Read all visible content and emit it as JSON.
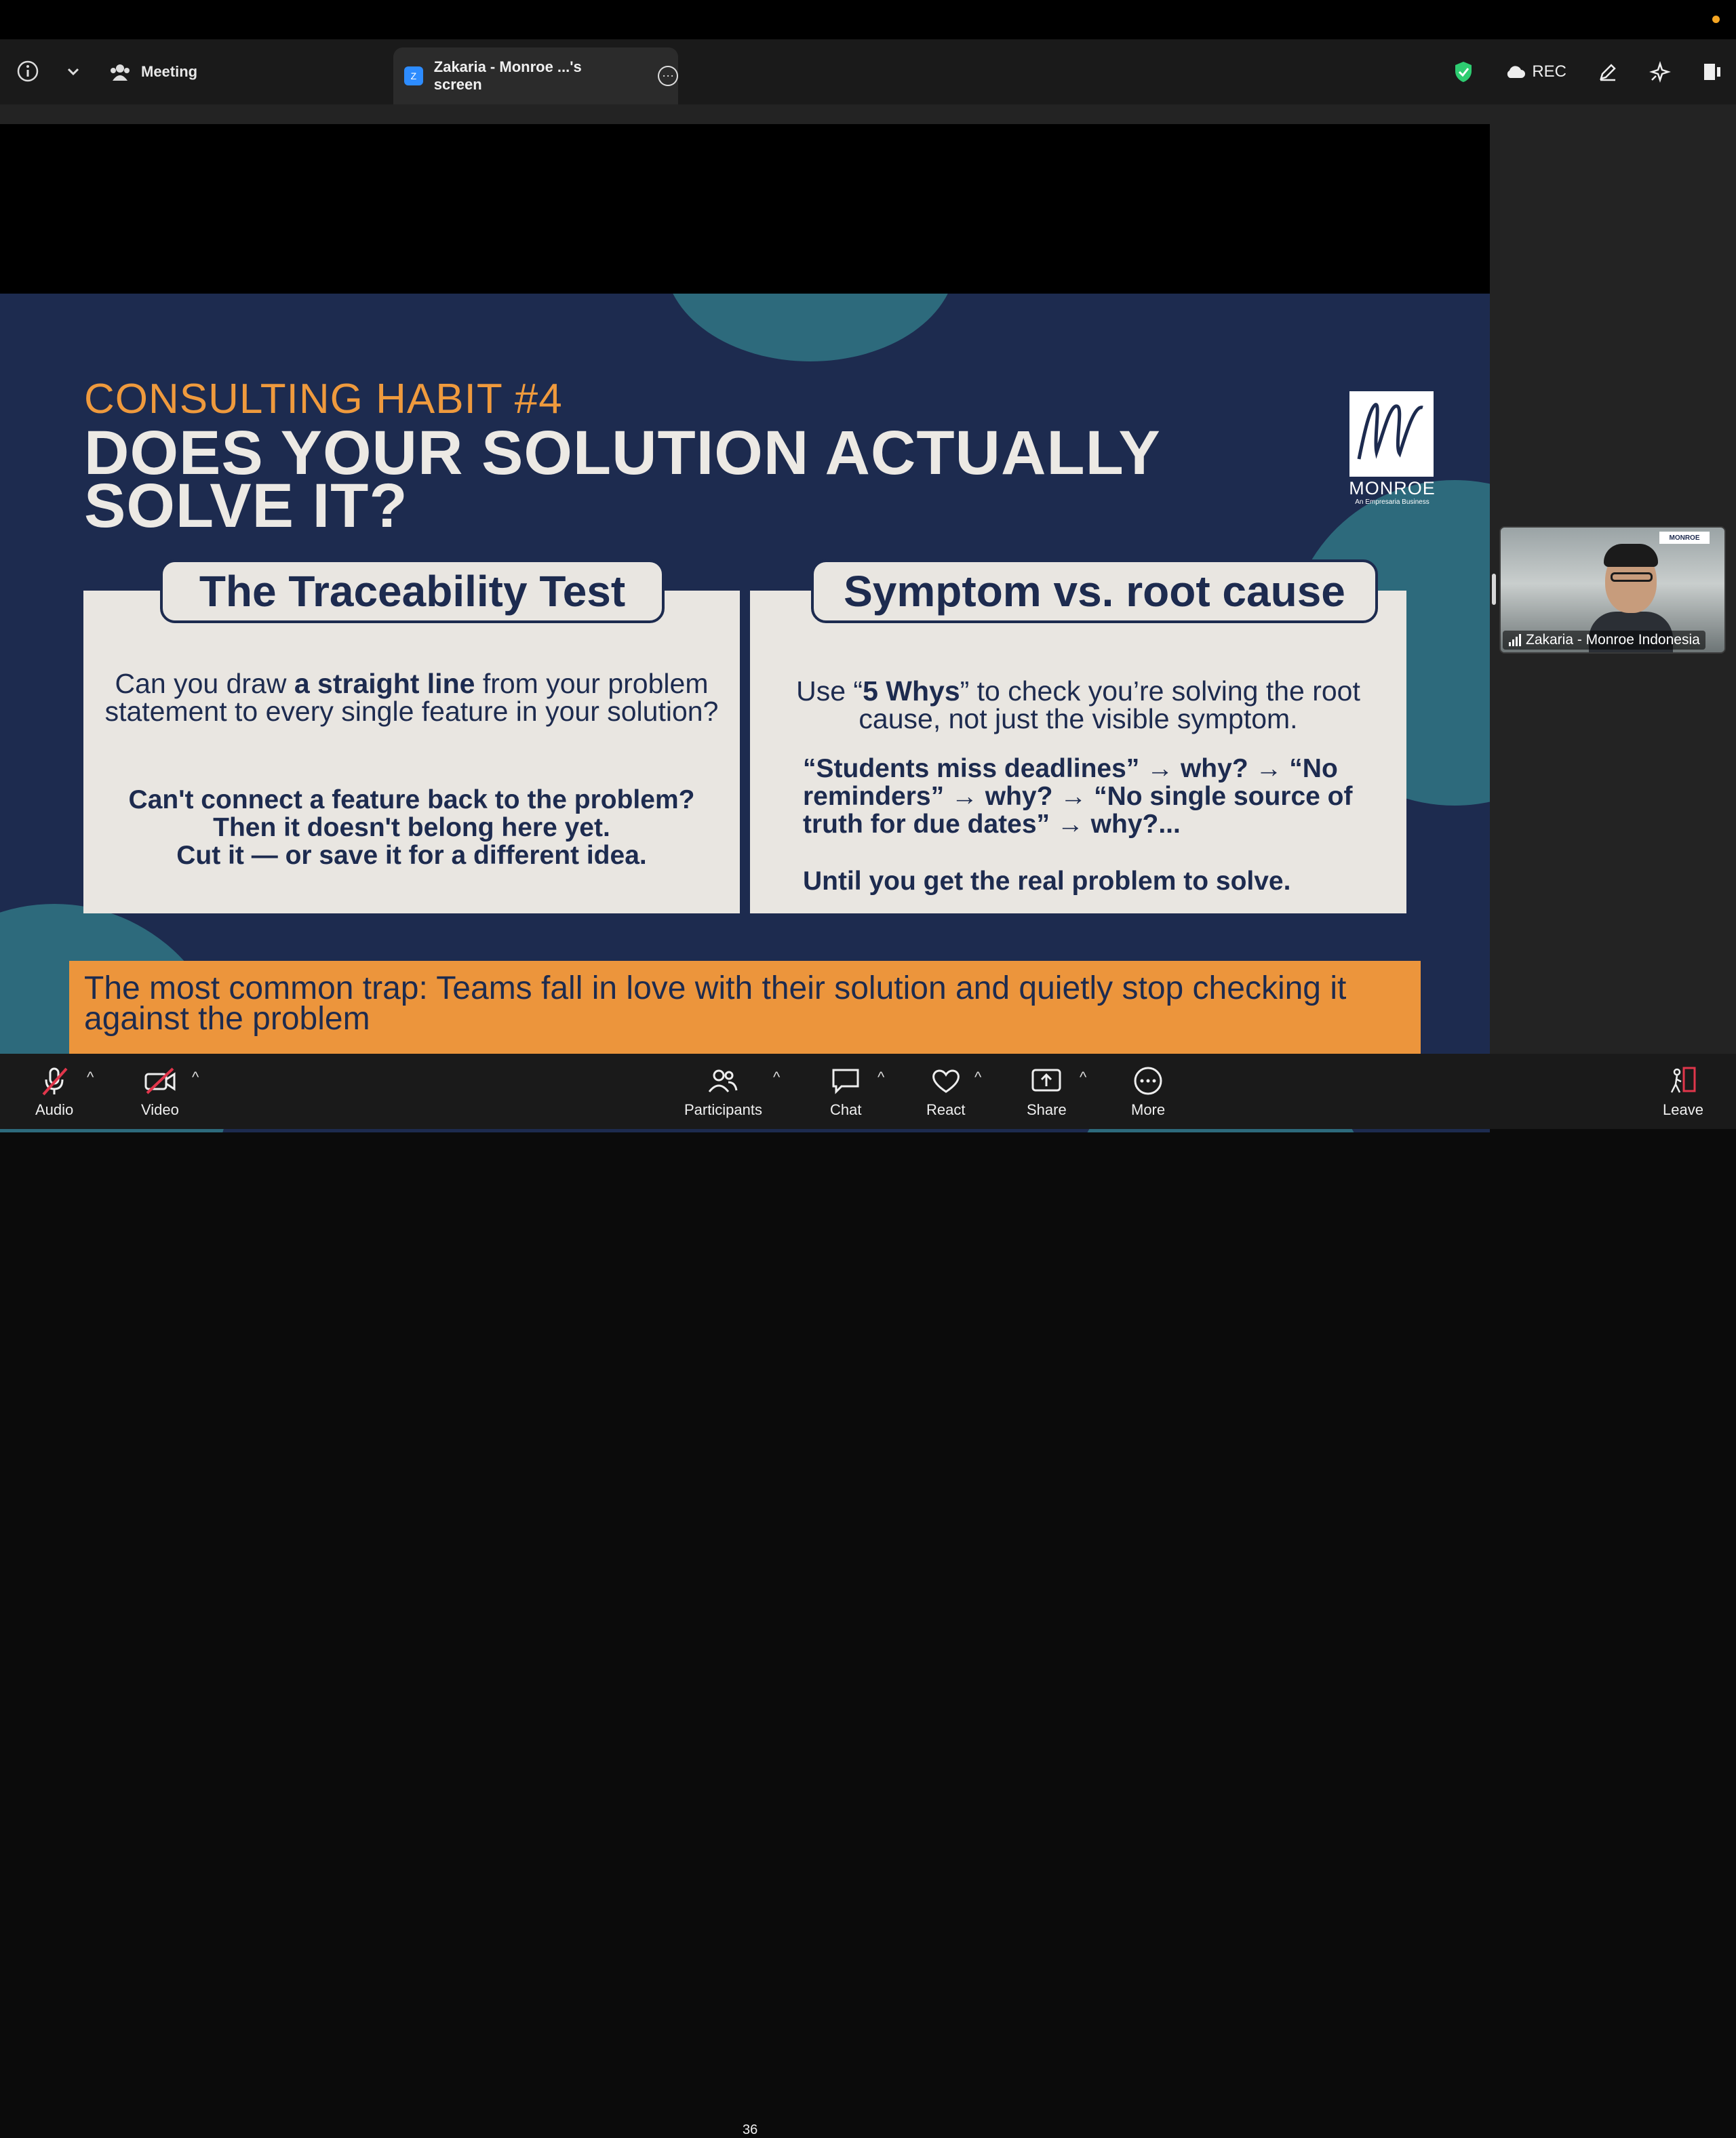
{
  "topbar": {
    "meeting_label": "Meeting",
    "share_tab_label": "Zakaria - Monroe ...'s screen",
    "share_tab_logo": "Z",
    "rec_label": "REC",
    "icons": [
      "info-icon",
      "chevron-down-icon",
      "participants-icon",
      "shield-check-icon",
      "cloud-icon",
      "pencil-icon",
      "sparkle-icon",
      "side-panel-icon"
    ],
    "shield_color": "#2ecc71"
  },
  "slide": {
    "kicker": "CONSULTING HABIT #4",
    "title": "DOES YOUR SOLUTION ACTUALLY SOLVE IT?",
    "logo_word": "MONROE",
    "logo_sub": "An Empresaria Business",
    "left_card": {
      "heading": "The Traceability Test",
      "question_prefix": "Can you draw ",
      "question_bold": "a straight line",
      "question_suffix": " from your problem statement to every single feature in your solution?",
      "strong_1": "Can't connect a feature back to the problem?",
      "strong_2": "Then it doesn't belong here yet.",
      "strong_3": "Cut it — or save it for a different idea."
    },
    "right_card": {
      "heading": "Symptom vs. root cause",
      "text_prefix": "Use “",
      "text_bold": "5 Whys",
      "text_suffix": "” to check you’re solving the root cause, not just the visible symptom.",
      "chain": "“Students miss deadlines” → why? → “No reminders” → why? → “No single source of truth for due dates” → why?...",
      "until": "Until you get the real problem to solve."
    },
    "banner": "The most common trap: Teams fall in love with their solution and quietly stop checking it against the problem",
    "colors": {
      "navy": "#1d2b4f",
      "orange": "#ec953c",
      "teal": "#2d6a7c",
      "card": "#e9e6e1"
    }
  },
  "video": {
    "name": "Zakaria - Monroe Indonesia",
    "mini_logo": "MONROE"
  },
  "bottombar": {
    "audio": "Audio",
    "video": "Video",
    "participants": "Participants",
    "participants_count": "36",
    "chat": "Chat",
    "react": "React",
    "share": "Share",
    "more": "More",
    "leave": "Leave"
  }
}
